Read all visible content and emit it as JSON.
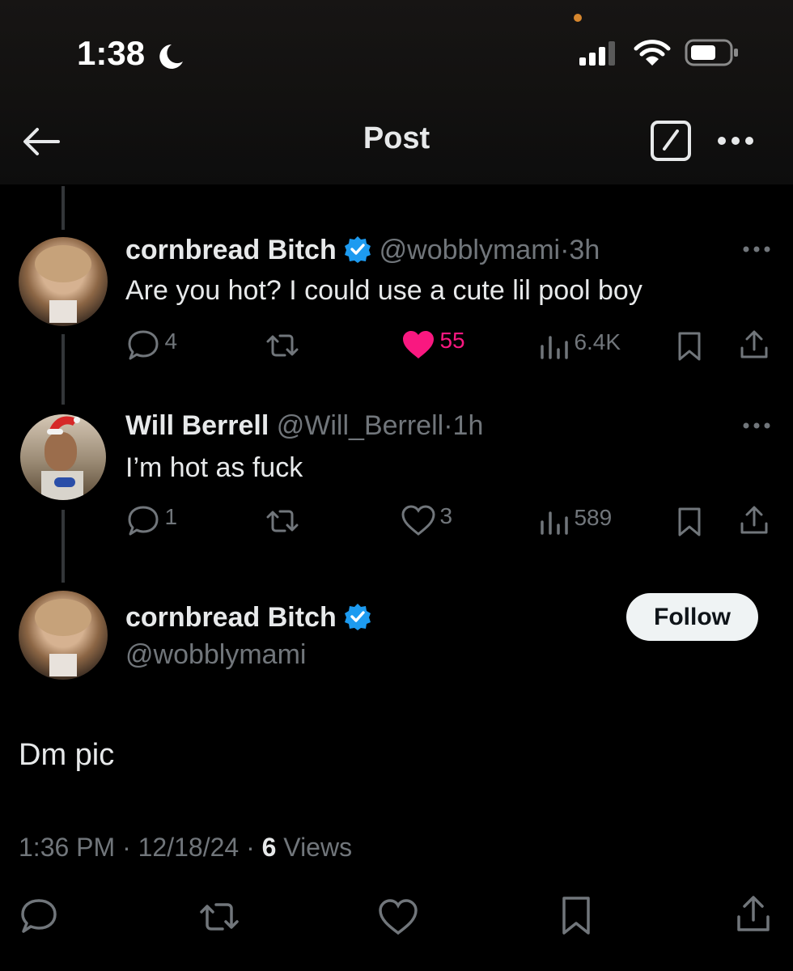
{
  "status_bar": {
    "time": "1:38"
  },
  "header": {
    "title": "Post"
  },
  "reply_1": {
    "display_name": "cornbread Bitch",
    "handle": "@wobblymami",
    "separator": "·",
    "age": "3h",
    "text": "Are you hot? I could use a cute lil pool boy",
    "replies": "4",
    "likes": "55",
    "views": "6.4K"
  },
  "reply_2": {
    "display_name": "Will Berrell",
    "handle": "@Will_Berrell",
    "separator": "·",
    "age": "1h",
    "text": "I’m hot as fuck",
    "replies": "1",
    "likes": "3",
    "views": "589"
  },
  "main_post": {
    "display_name": "cornbread Bitch",
    "handle": "@wobblymami",
    "follow_label": "Follow",
    "text": "Dm pic",
    "time": "1:36 PM",
    "date": "12/18/24",
    "sep": "·",
    "views_count": "6",
    "views_label": "Views"
  },
  "colors": {
    "like": "#f91880",
    "verified": "#1d9bf0",
    "muted": "#71767b",
    "background": "#000000"
  }
}
